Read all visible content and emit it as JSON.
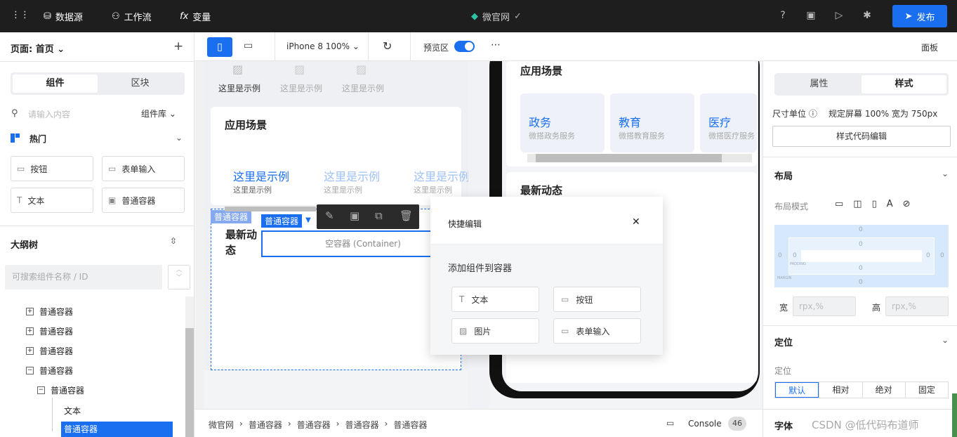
{
  "topbar": {
    "datasource": "数据源",
    "workflow": "工作流",
    "variable": "变量",
    "app_name": "微官网",
    "publish": "发布"
  },
  "left": {
    "page_label": "页面: 首页",
    "tabs": [
      "组件",
      "区块"
    ],
    "search_placeholder": "请输入内容",
    "library": "组件库",
    "hot": "热门",
    "components": [
      "按钮",
      "表单输入",
      "文本",
      "普通容器"
    ],
    "outline": "大纲树",
    "outline_search": "可搜索组件名称 / ID",
    "tree": [
      "普通容器",
      "普通容器",
      "普通容器",
      "普通容器",
      "普通容器",
      "文本",
      "普通容器"
    ]
  },
  "toolbar": {
    "device": "iPhone 8 100%",
    "preview": "预览区",
    "panel": "面板"
  },
  "canvas": {
    "examples": [
      "这里是示例",
      "这里是示例",
      "这里是示例"
    ],
    "scene_title": "应用场景",
    "scene_items": [
      {
        "title": "这里是示例",
        "sub": "这里是示例"
      },
      {
        "title": "这里是示例",
        "sub": "这里是示例"
      },
      {
        "title": "这里是示例",
        "sub": "这里是示例"
      }
    ],
    "container_tag": "普通容器",
    "inner_tag": "普通容器",
    "news_title": "最新动态",
    "empty_container": "空容器 (Container)"
  },
  "phone": {
    "scene_title": "应用场景",
    "cards": [
      {
        "title": "政务",
        "sub": "微搭政务服务"
      },
      {
        "title": "教育",
        "sub": "微搭教育服务"
      },
      {
        "title": "医疗",
        "sub": "微搭医疗服务"
      }
    ],
    "news_title": "最新动态"
  },
  "popup": {
    "title": "快捷编辑",
    "subtitle": "添加组件到容器",
    "items": [
      "文本",
      "按钮",
      "图片",
      "表单输入"
    ]
  },
  "right": {
    "tabs": [
      "属性",
      "样式"
    ],
    "unit_label": "尺寸单位",
    "unit_value": "规定屏幕 100% 宽为 750px",
    "code_edit": "样式代码编辑",
    "layout": "布局",
    "layout_mode": "布局模式",
    "box_values": [
      "0",
      "0",
      "0",
      "0",
      "0",
      "0",
      "0",
      "0"
    ],
    "padding_label": "PADDING",
    "margin_label": "MARGIN",
    "width_label": "宽",
    "height_label": "高",
    "wh_placeholder": "rpx,%",
    "position": "定位",
    "position_label": "定位",
    "position_options": [
      "默认",
      "相对",
      "绝对",
      "固定"
    ],
    "font": "字体"
  },
  "bottom": {
    "breadcrumb": [
      "微官网",
      "普通容器",
      "普通容器",
      "普通容器",
      "普通容器"
    ],
    "console": "Console",
    "console_count": "46"
  },
  "watermark": "CSDN @低代码布道师"
}
